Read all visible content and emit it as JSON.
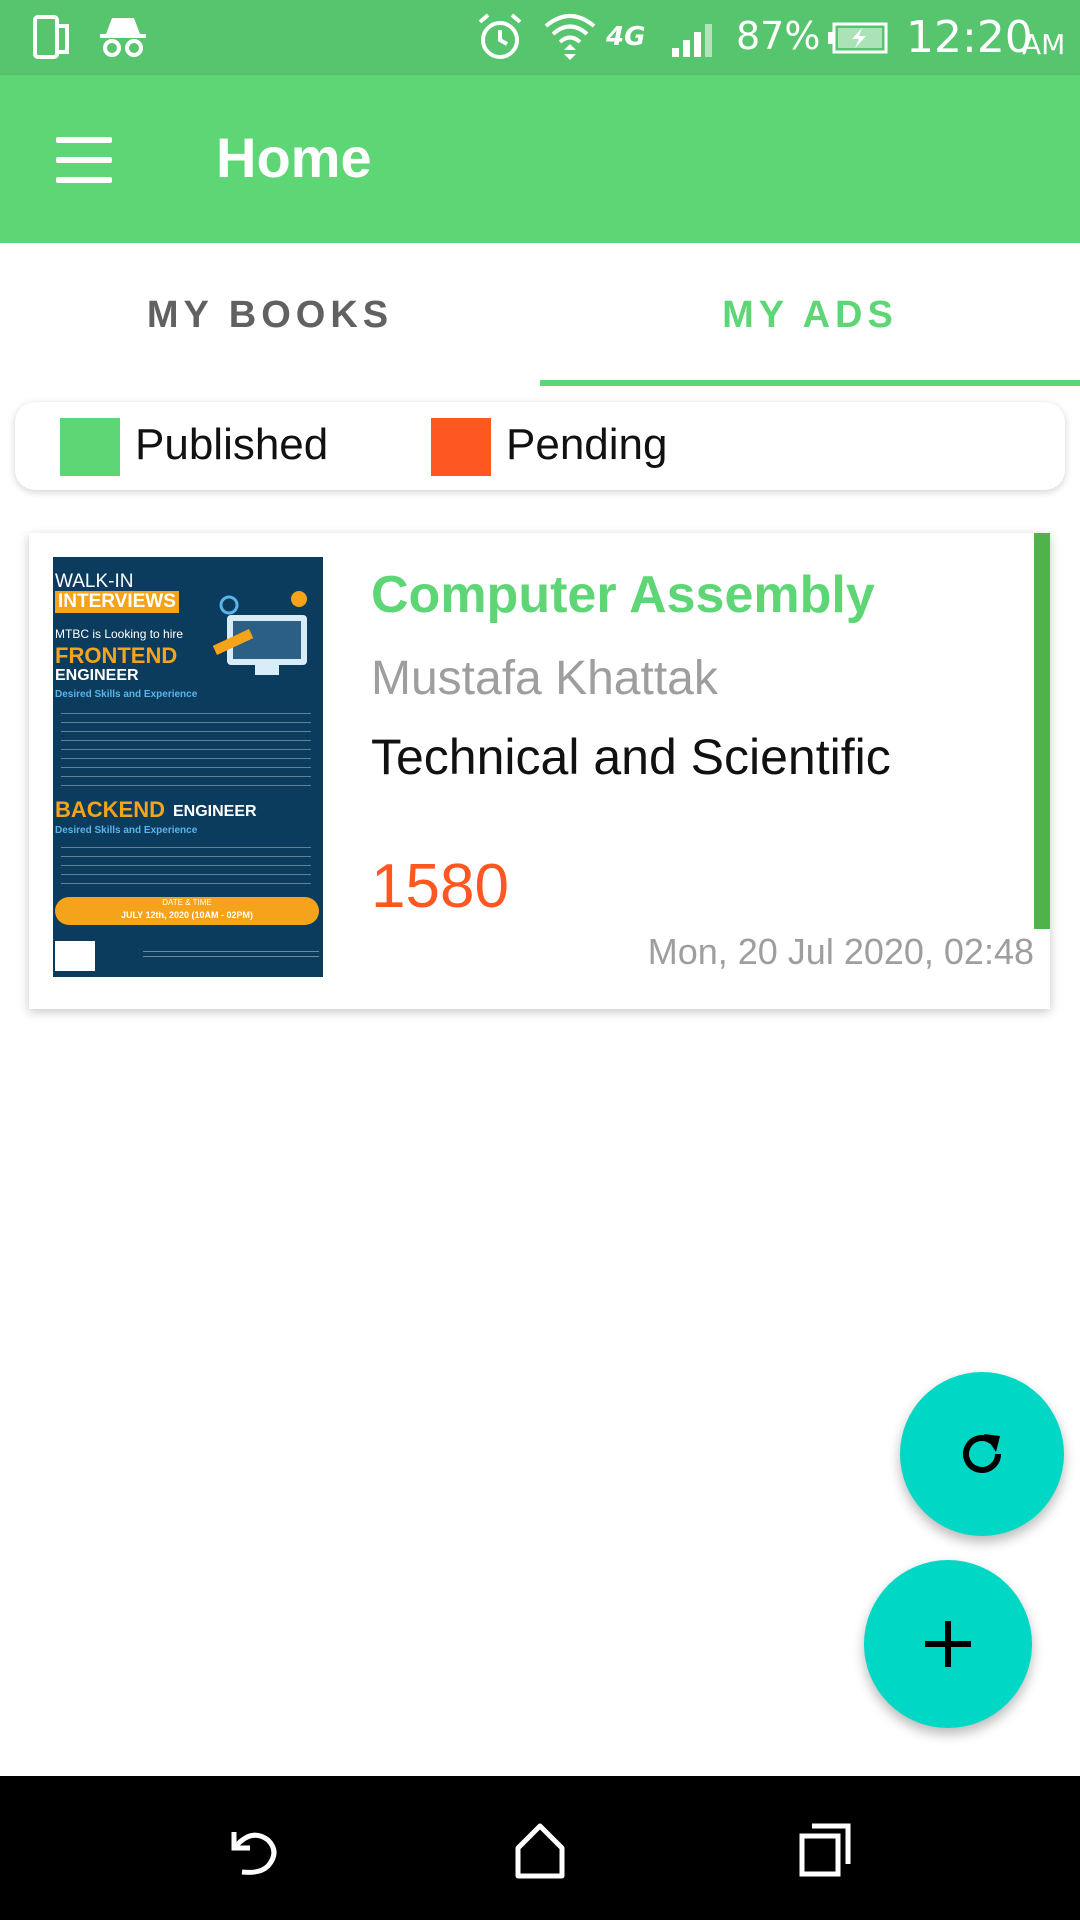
{
  "status_bar": {
    "network": "4G",
    "battery": "87%",
    "time": "12:20",
    "ampm": "AM"
  },
  "app_bar": {
    "title": "Home",
    "background": "#5ed676"
  },
  "tabs": [
    {
      "label": "MY BOOKS",
      "selected": false
    },
    {
      "label": "MY ADS",
      "selected": true
    }
  ],
  "legend": [
    {
      "label": "Published",
      "color": "#5ed676"
    },
    {
      "label": "Pending",
      "color": "#ff5722"
    }
  ],
  "ads": [
    {
      "title": "Computer Assembly",
      "author": "Mustafa Khattak",
      "category": "Technical and Scientific",
      "price": "1580",
      "date": "Mon, 20 Jul 2020, 02:48",
      "status_color": "#4fb34a",
      "thumbnail": {
        "line1": "WALK-IN",
        "line2": "INTERVIEWS",
        "line3": "MTBC is Looking to hire",
        "line4": "FRONTEND",
        "line5": "ENGINEER",
        "line6": "Desired Skills and Experience",
        "line7": "BACKEND",
        "line8": "ENGINEER",
        "line9": "Desired Skills and Experience",
        "date_label": "DATE & TIME",
        "date_value": "JULY 12th, 2020 (10AM - 02PM)"
      }
    }
  ],
  "icons": {
    "refresh": "refresh-icon",
    "add": "plus-icon",
    "menu": "hamburger-menu-icon",
    "back": "back-icon",
    "home": "home-icon",
    "recents": "recents-icon"
  },
  "fab_color": "#00d7c4"
}
